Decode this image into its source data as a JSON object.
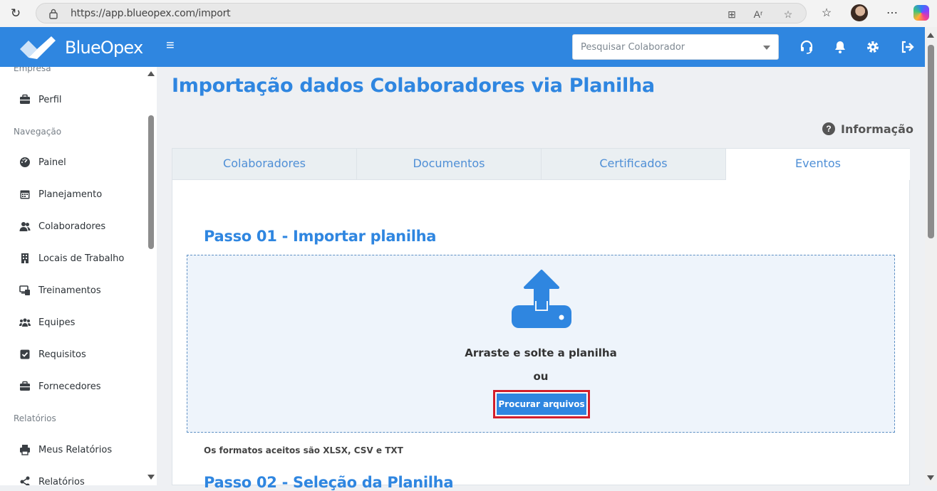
{
  "browser": {
    "url": "https://app.blueopex.com/import"
  },
  "header": {
    "logo_text": "BlueOpex",
    "search_placeholder": "Pesquisar Colaborador"
  },
  "sidebar": {
    "top_partial_section": "Empresa",
    "sections": [
      {
        "label": "Navegação"
      },
      {
        "label": "Relatórios"
      }
    ],
    "items": [
      {
        "label": "Perfil",
        "icon": "briefcase-icon"
      },
      {
        "label": "Painel",
        "icon": "dashboard-icon"
      },
      {
        "label": "Planejamento",
        "icon": "calendar-icon"
      },
      {
        "label": "Colaboradores",
        "icon": "users-icon"
      },
      {
        "label": "Locais de Trabalho",
        "icon": "building-icon"
      },
      {
        "label": "Treinamentos",
        "icon": "training-icon"
      },
      {
        "label": "Equipes",
        "icon": "team-icon"
      },
      {
        "label": "Requisitos",
        "icon": "checkbox-icon"
      },
      {
        "label": "Fornecedores",
        "icon": "briefcase-icon"
      },
      {
        "label": "Meus Relatórios",
        "icon": "printer-icon"
      },
      {
        "label": "Relatórios",
        "icon": "share-icon"
      }
    ]
  },
  "main": {
    "title": "Importação dados Colaboradores via Planilha",
    "info_label": "Informação",
    "tabs": [
      {
        "label": "Colaboradores",
        "active": false
      },
      {
        "label": "Documentos",
        "active": false
      },
      {
        "label": "Certificados",
        "active": false
      },
      {
        "label": "Eventos",
        "active": true
      }
    ],
    "step1_title": "Passo 01 - Importar planilha",
    "dropzone_text": "Arraste e solte a planilha",
    "dropzone_or": "ou",
    "browse_button": "Procurar arquivos",
    "formats_note": "Os formatos aceitos são XLSX, CSV e TXT",
    "step2_title": "Passo 02 - Seleção da Planilha"
  },
  "colors": {
    "brand_blue": "#2f86e0",
    "highlight_red": "#d21f2b"
  }
}
